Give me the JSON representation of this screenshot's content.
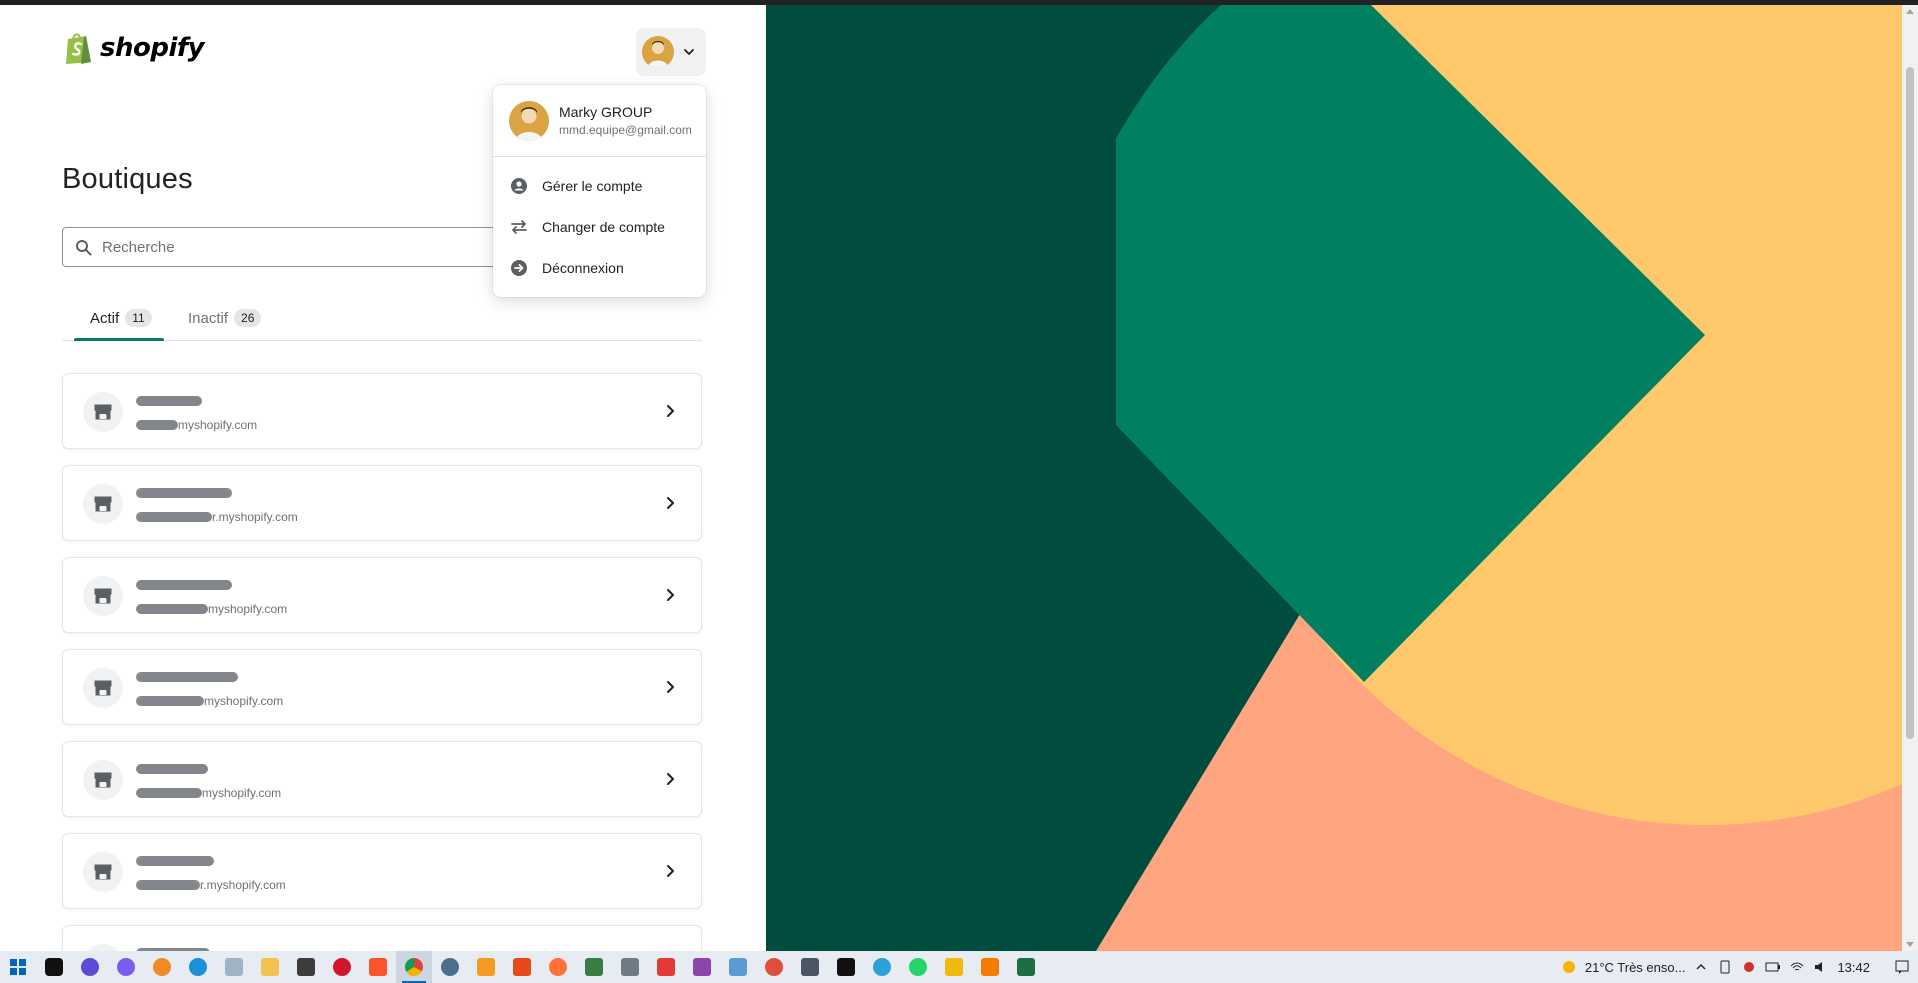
{
  "header": {
    "logo_text": "shopify"
  },
  "page": {
    "title": "Boutiques"
  },
  "search": {
    "placeholder": "Recherche",
    "value": ""
  },
  "tabs": [
    {
      "label": "Actif",
      "count": "11",
      "active": true
    },
    {
      "label": "Inactif",
      "count": "26",
      "active": false
    }
  ],
  "stores": [
    {
      "url_suffix": "myshopify.com"
    },
    {
      "url_suffix": "r.myshopify.com"
    },
    {
      "url_suffix": "myshopify.com"
    },
    {
      "url_suffix": "myshopify.com"
    },
    {
      "url_suffix": "myshopify.com"
    },
    {
      "url_suffix": "r.myshopify.com"
    },
    {
      "url_suffix": ""
    }
  ],
  "account_menu": {
    "name": "Marky GROUP",
    "email": "mmd.equipe@gmail.com",
    "items": [
      {
        "label": "Gérer le compte",
        "icon": "person-circle-icon"
      },
      {
        "label": "Changer de compte",
        "icon": "switch-arrows-icon"
      },
      {
        "label": "Déconnexion",
        "icon": "arrow-circle-right-icon"
      }
    ]
  },
  "taskbar": {
    "weather": "21°C  Très enso...",
    "time": "13:42"
  },
  "colors": {
    "accent": "#008060",
    "dark_green": "#004c3f",
    "mid_green": "#008060",
    "yellow": "#ffc96b",
    "salmon": "#ffa680"
  }
}
